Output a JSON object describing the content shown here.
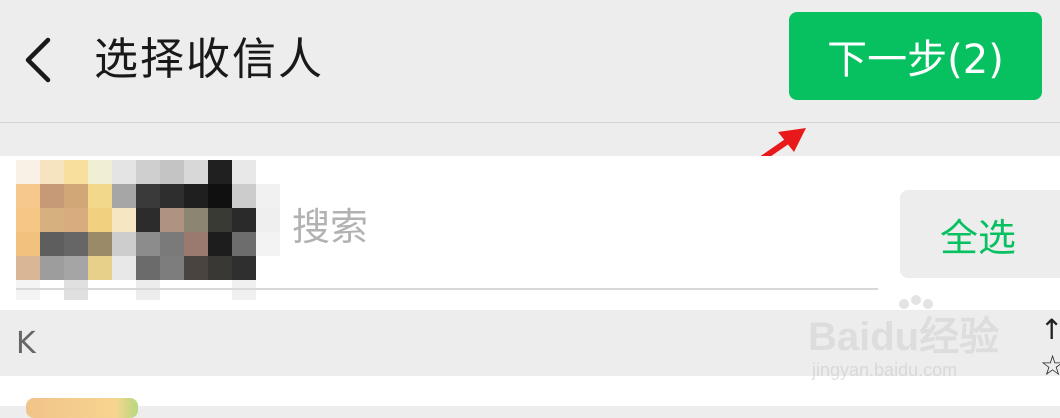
{
  "header": {
    "title": "选择收信人",
    "next_button_label": "下一步(2)"
  },
  "search": {
    "placeholder": "搜索",
    "select_all_label": "全选"
  },
  "contacts": {
    "section_letter": "K"
  },
  "index_bar": {
    "items": [
      "↑",
      "☆"
    ]
  },
  "watermark": {
    "brand": "Baidu经验",
    "url": "jingyan.baidu.com"
  },
  "colors": {
    "accent": "#07c160",
    "header_bg": "#ededed",
    "annotation_arrow": "#e8191a"
  },
  "icons": {
    "back": "chevron-left-icon"
  }
}
